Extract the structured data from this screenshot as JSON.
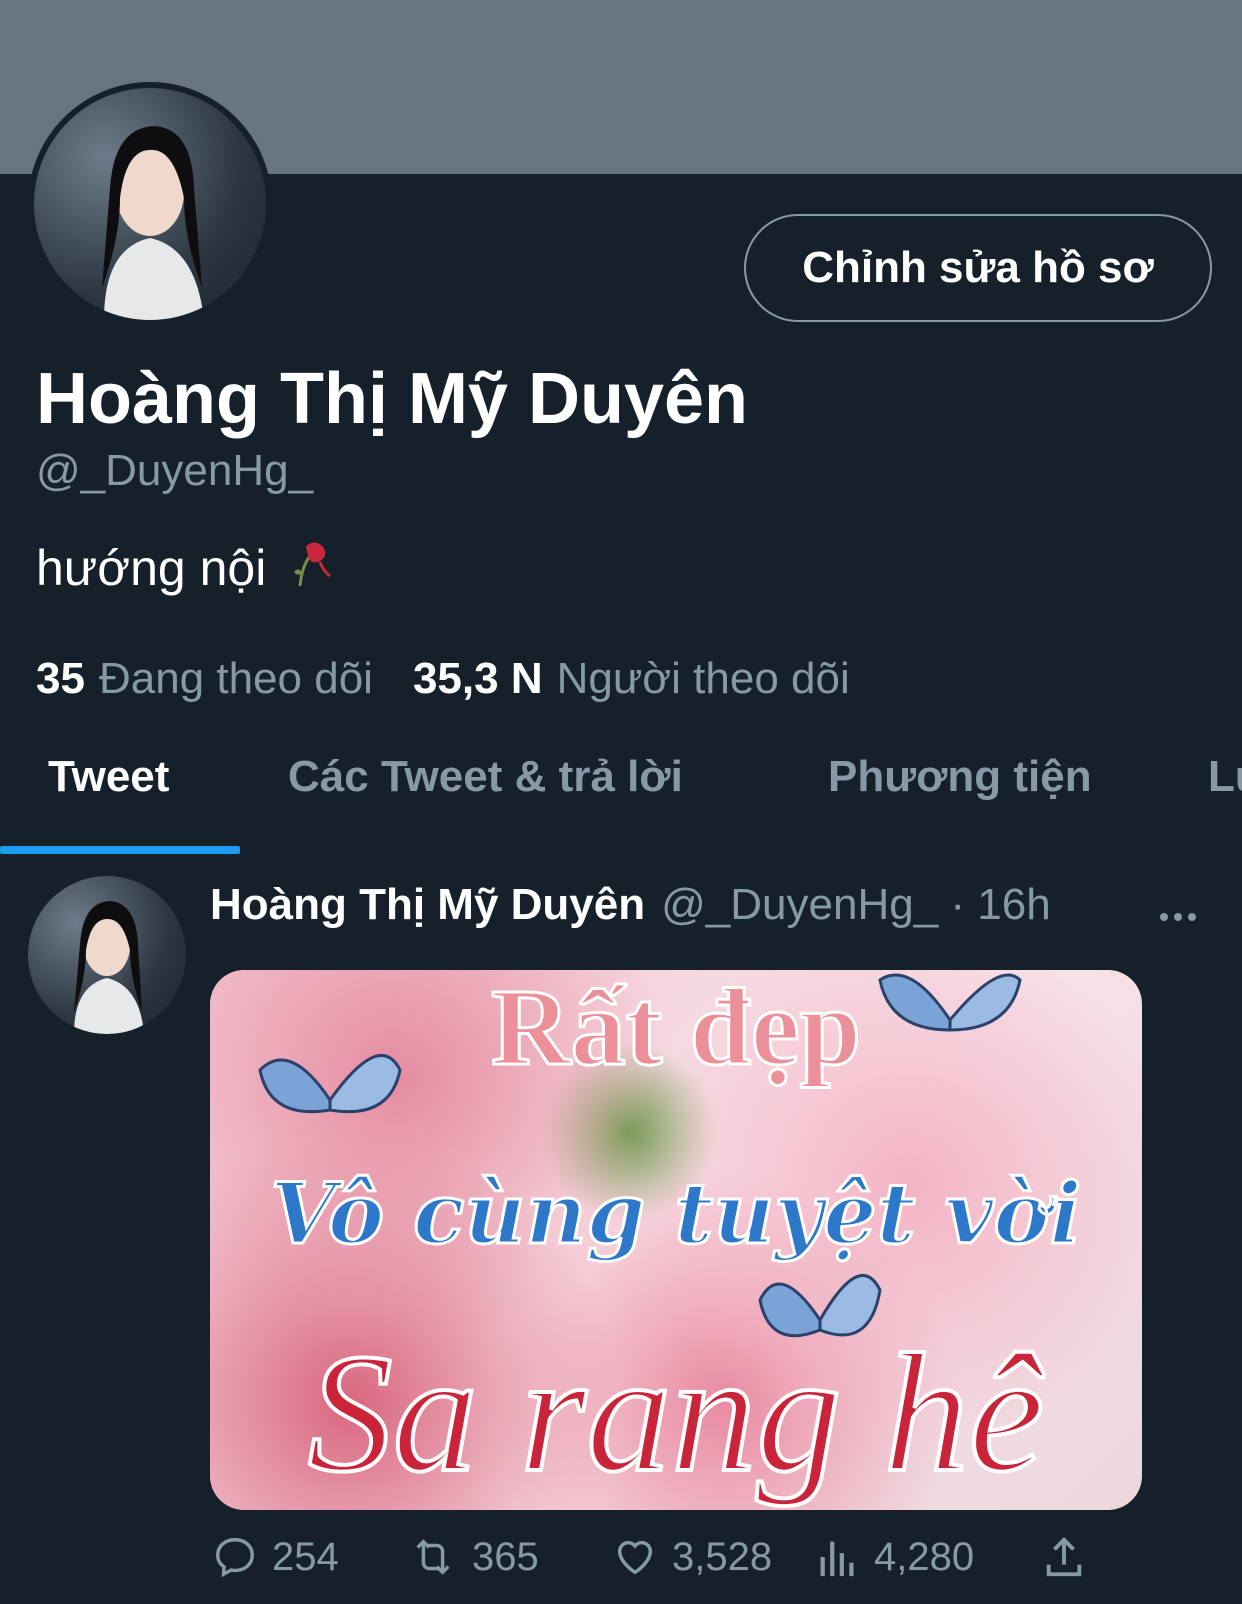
{
  "profile": {
    "display_name": "Hoàng Thị Mỹ Duyên",
    "handle": "@_DuyenHg_",
    "bio": "hướng nội",
    "bio_emoji": "wilted-rose-icon",
    "edit_button": "Chỉnh sửa hồ sơ",
    "following_count": "35",
    "following_label": "Đang theo dõi",
    "followers_count": "35,3 N",
    "followers_label": "Người theo dõi"
  },
  "tabs": [
    {
      "label": "Tweet",
      "active": true
    },
    {
      "label": "Các Tweet & trả lời",
      "active": false
    },
    {
      "label": "Phương tiện",
      "active": false
    },
    {
      "label": "Lư",
      "active": false
    }
  ],
  "tweet": {
    "name": "Hoàng Thị Mỹ Duyên",
    "meta": "@_DuyenHg_ · 16h",
    "more_icon": "more-dots-icon",
    "media_text": [
      "Rất đẹp",
      "Vô cùng tuyệt vời",
      "Sa rang hê"
    ],
    "reply_count": "254",
    "retweet_count": "365",
    "like_count": "3,528",
    "view_count": "4,280"
  },
  "colors": {
    "background": "#15202b",
    "banner": "#66757f",
    "accent": "#1d9bf0",
    "muted_text": "#8899a6"
  }
}
